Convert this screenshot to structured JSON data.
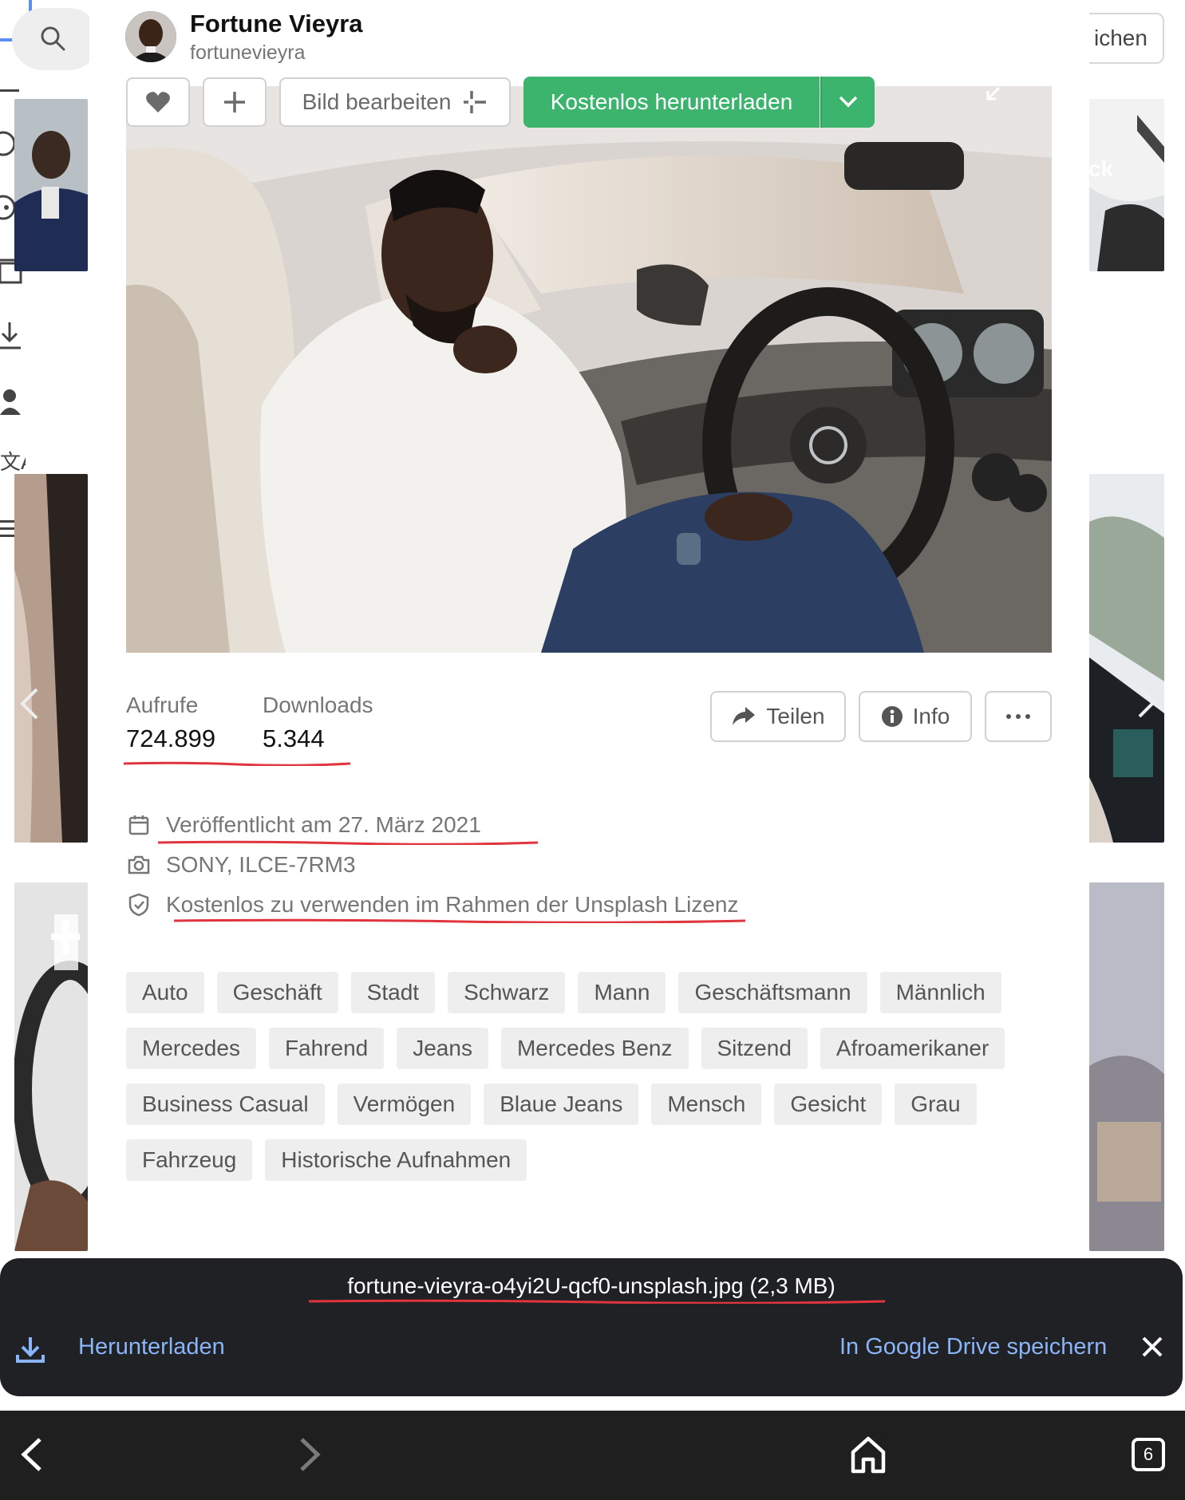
{
  "author": {
    "name": "Fortune Vieyra",
    "handle": "fortunevieyra"
  },
  "toolbar": {
    "edit_label": "Bild bearbeiten",
    "download_label": "Kostenlos herunterladen"
  },
  "background": {
    "right_button_partial": "ichen",
    "right_thumb_caption_partial": "ck"
  },
  "stats": {
    "views_label": "Aufrufe",
    "views_value": "724.899",
    "downloads_label": "Downloads",
    "downloads_value": "5.344"
  },
  "actions": {
    "share_label": "Teilen",
    "info_label": "Info"
  },
  "meta": {
    "published": "Veröffentlicht am 27. März 2021",
    "camera": "SONY, ILCE-7RM3",
    "license": "Kostenlos zu verwenden im Rahmen der Unsplash Lizenz"
  },
  "tags": [
    "Auto",
    "Geschäft",
    "Stadt",
    "Schwarz",
    "Mann",
    "Geschäftsmann",
    "Männlich",
    "Mercedes",
    "Fahrend",
    "Jeans",
    "Mercedes Benz",
    "Sitzend",
    "Afroamerikaner",
    "Business Casual",
    "Vermögen",
    "Blaue Jeans",
    "Mensch",
    "Gesicht",
    "Grau",
    "Fahrzeug",
    "Historische Aufnahmen"
  ],
  "download_bar": {
    "filename": "fortune-vieyra-o4yi2U-qcf0-unsplash.jpg (2,3 MB)",
    "download_label": "Herunterladen",
    "drive_label": "In Google Drive speichern"
  },
  "navbar": {
    "tab_count": "6"
  },
  "colors": {
    "accent_green": "#3cb46e",
    "annotation_red": "#e0343f",
    "link_blue": "#8ab4f8",
    "bar_dark": "#202124"
  }
}
